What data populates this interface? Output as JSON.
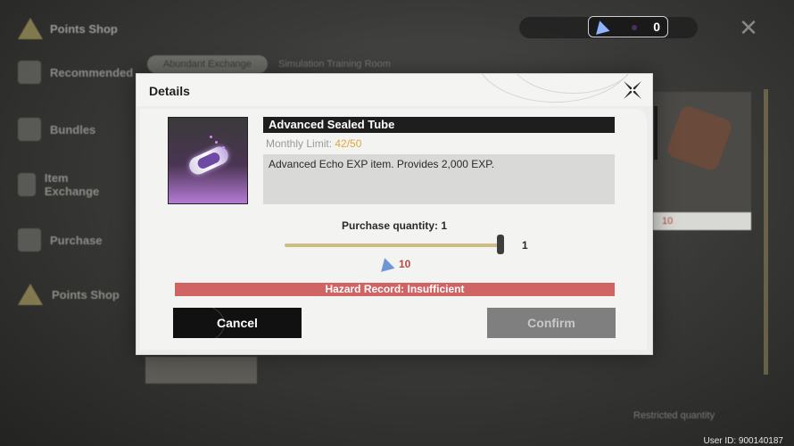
{
  "background": {
    "shop_title": "Points Shop",
    "sidebar_items": [
      "Recommended",
      "Bundles",
      "Item Exchange",
      "Purchase",
      "Points Shop"
    ],
    "tabs": [
      "Abundant Exchange",
      "Simulation Training Room"
    ],
    "currency_value": "0",
    "user_id": "User ID: 900140187",
    "card_price": "10",
    "bottom_text": "Restricted quantity"
  },
  "modal": {
    "title": "Details",
    "item": {
      "name": "Advanced Sealed Tube",
      "limit_label": "Monthly Limit:",
      "limit_value": "42/50",
      "description": "Advanced Echo EXP item. Provides 2,000 EXP."
    },
    "quantity_label": "Purchase quantity: 1",
    "slider": {
      "value": 1,
      "max_label": "1"
    },
    "cost": {
      "icon": "hazard-record-gem-icon",
      "value": "10"
    },
    "warning": "Hazard Record: Insufficient",
    "buttons": {
      "cancel": "Cancel",
      "confirm": "Confirm"
    }
  },
  "colors": {
    "warning_red": "#d06363",
    "limit_orange": "#e4a53b",
    "cost_red": "#b74a45",
    "slider_track": "#cdbd83"
  }
}
